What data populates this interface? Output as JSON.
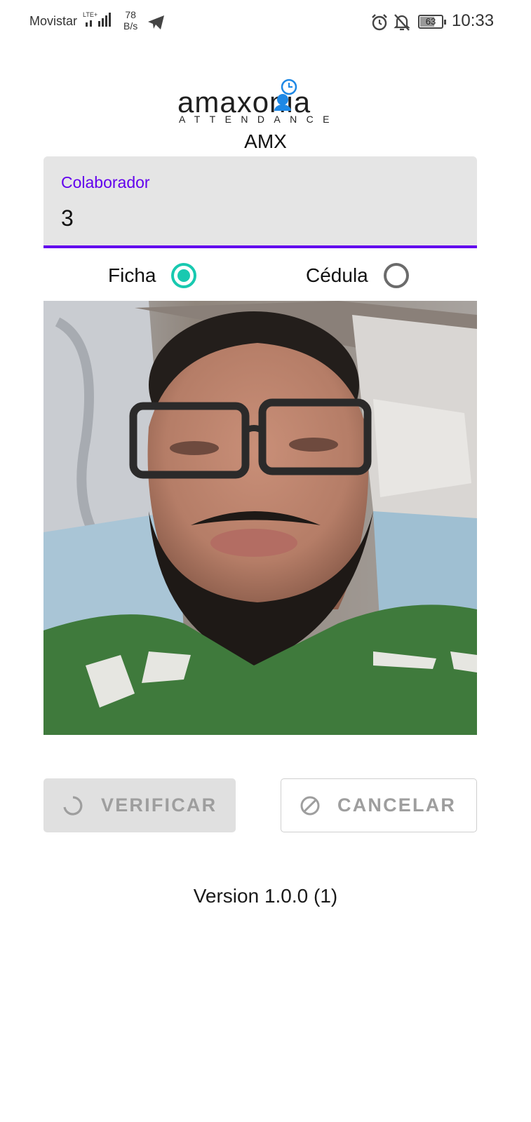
{
  "status_bar": {
    "carrier": "Movistar",
    "network": "LTE+",
    "speed_value": "78",
    "speed_unit": "B/s",
    "battery": "63",
    "time": "10:33"
  },
  "header": {
    "logo_text": "amaxonia",
    "logo_subtitle": "ATTENDANCE",
    "app_name": "AMX"
  },
  "form": {
    "field_label": "Colaborador",
    "field_value": "3",
    "radio_options": [
      {
        "label": "Ficha",
        "selected": true
      },
      {
        "label": "Cédula",
        "selected": false
      }
    ]
  },
  "buttons": {
    "verify_label": "VERIFICAR",
    "cancel_label": "CANCELAR"
  },
  "footer": {
    "version": "Version 1.0.0 (1)"
  },
  "colors": {
    "accent": "#6200ee",
    "radio": "#18c9b0",
    "logo_icon": "#1e88e5"
  }
}
